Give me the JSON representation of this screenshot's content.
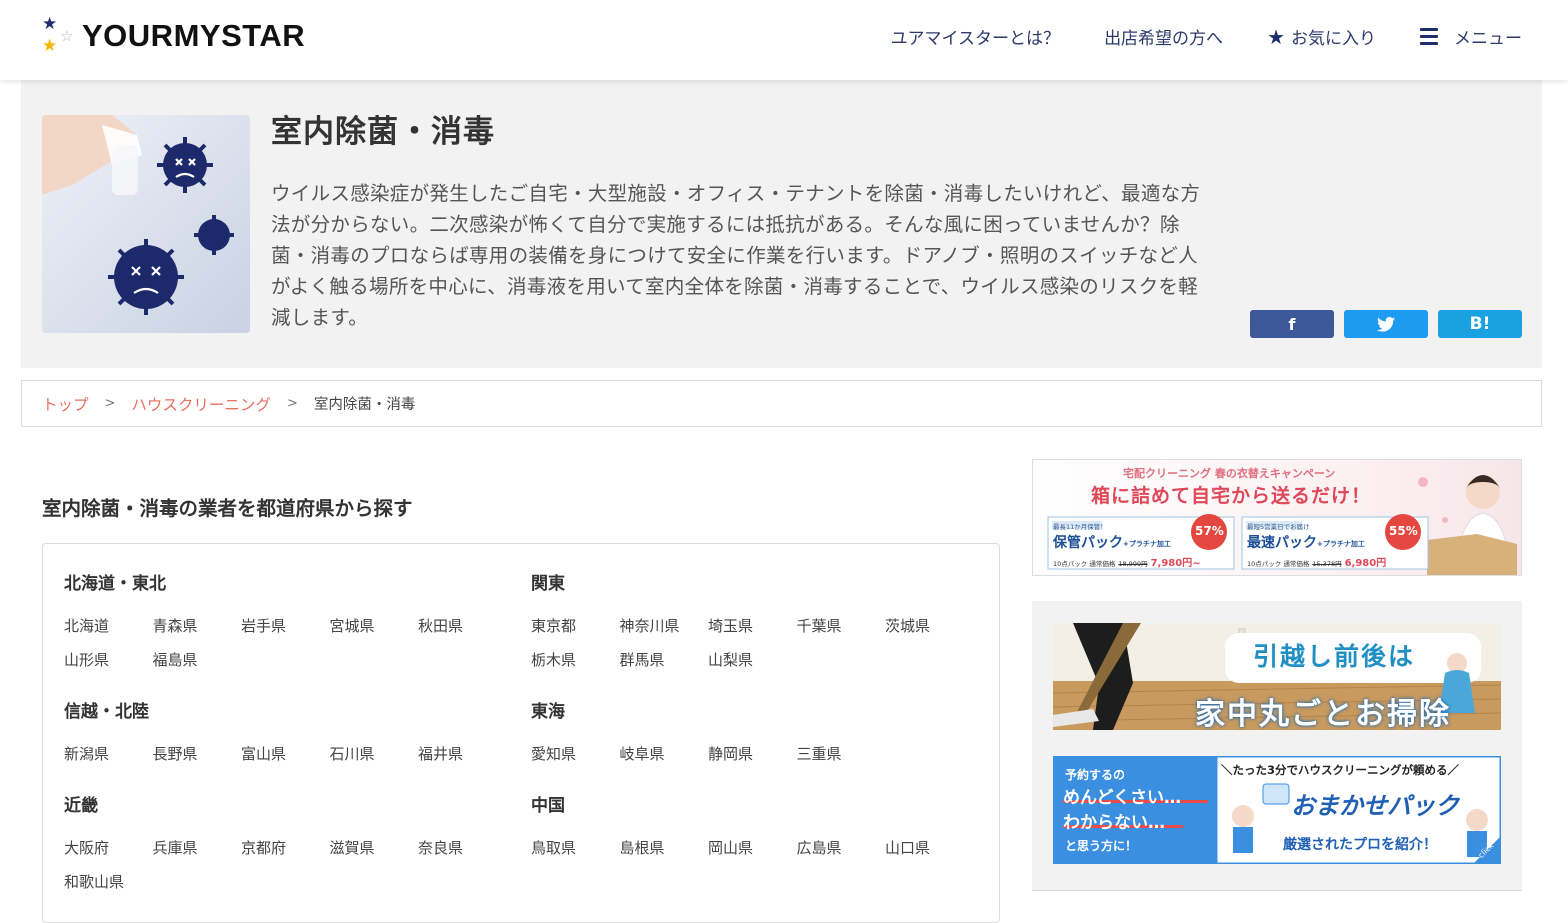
{
  "header": {
    "logo_text": "YOURMYSTAR",
    "nav": [
      {
        "label": "ユアマイスターとは？"
      },
      {
        "label": "出店希望の方へ"
      },
      {
        "label": "お気に入り"
      },
      {
        "label": "メニュー"
      }
    ]
  },
  "hero": {
    "title": "室内除菌・消毒",
    "description": "ウイルス感染症が発生したご自宅・大型施設・オフィス・テナントを除菌・消毒したいけれど、最適な方法が分からない。二次感染が怖くて自分で実施するには抵抗がある。そんな風に困っていませんか？除菌・消毒のプロならば専用の装備を身につけて安全に作業を行います。ドアノブ・照明のスイッチなど人がよく触る場所を中心に、消毒液を用いて室内全体を除菌・消毒することで、ウイルス感染のリスクを軽減します。",
    "share": {
      "facebook": "f",
      "twitter": "t",
      "hatena": "B!"
    }
  },
  "breadcrumb": {
    "items": [
      "トップ",
      "ハウスクリーニング"
    ],
    "separator": ">",
    "current": "室内除菌・消毒"
  },
  "search": {
    "title": "室内除菌・消毒の業者を都道府県から探す",
    "regions": [
      {
        "name": "北海道・東北",
        "prefectures": [
          "北海道",
          "青森県",
          "岩手県",
          "宮城県",
          "秋田県",
          "山形県",
          "福島県"
        ]
      },
      {
        "name": "関東",
        "prefectures": [
          "東京都",
          "神奈川県",
          "埼玉県",
          "千葉県",
          "茨城県",
          "栃木県",
          "群馬県",
          "山梨県"
        ]
      },
      {
        "name": "信越・北陸",
        "prefectures": [
          "新潟県",
          "長野県",
          "富山県",
          "石川県",
          "福井県"
        ]
      },
      {
        "name": "東海",
        "prefectures": [
          "愛知県",
          "岐阜県",
          "静岡県",
          "三重県"
        ]
      },
      {
        "name": "近畿",
        "prefectures": [
          "大阪府",
          "兵庫県",
          "京都府",
          "滋賀県",
          "奈良県",
          "和歌山県"
        ]
      },
      {
        "name": "中国",
        "prefectures": [
          "鳥取県",
          "島根県",
          "岡山県",
          "広島県",
          "山口県"
        ]
      }
    ]
  },
  "sidebar": {
    "ad1": {
      "campaign": "宅配クリーニング 春の衣替えキャンペーン",
      "headline": "箱に詰めて自宅から送るだけ！",
      "left": {
        "tag": "最長11か月保管！",
        "name": "保管パック",
        "sub": "+プラチナ加工",
        "discount": "57%",
        "price_note": "10点パック 通常価格",
        "old_price": "18,999円",
        "new_price": "7,980円~"
      },
      "right": {
        "tag": "最短5営業日でお届け",
        "name": "最速パック",
        "sub": "+プラチナ加工",
        "discount": "55%",
        "price_note": "10点パック 通常価格",
        "old_price": "15,378円",
        "new_price": "6,980円"
      }
    },
    "ad2": {
      "line1": "引越し前後は",
      "line2": "家中丸ごとお掃除"
    },
    "ad3": {
      "left_top": "予約するの",
      "left_mid1": "めんどくさい…",
      "left_mid2": "わからない…",
      "left_bottom": "と思う方に！",
      "right_top": "＼たった3分でハウスクリーニングが頼める／",
      "right_title": "おまかせパック",
      "right_bottom": "厳選されたプロを紹介！",
      "click": "click"
    }
  }
}
